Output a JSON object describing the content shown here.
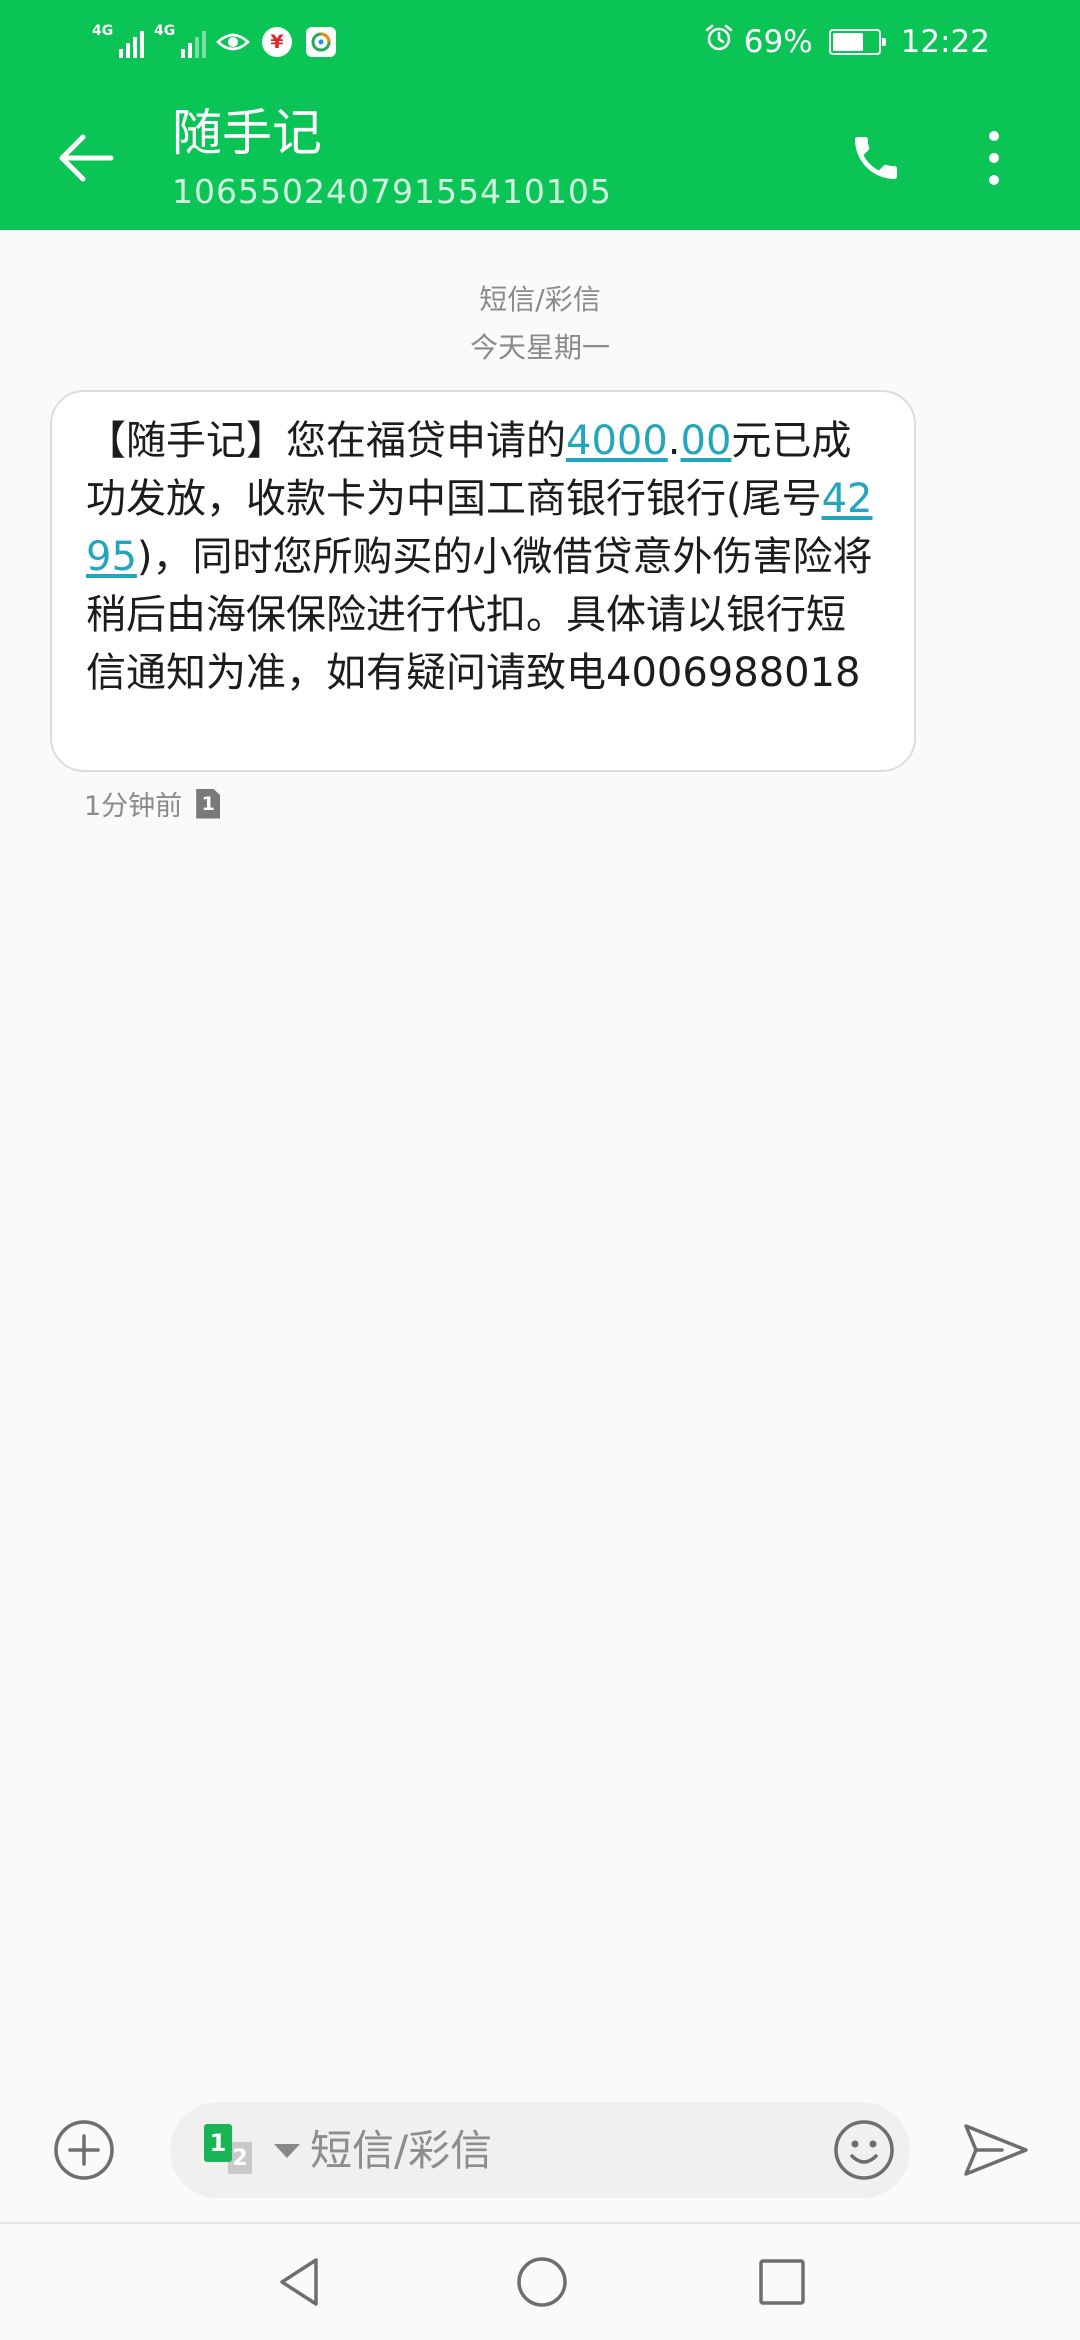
{
  "status_bar": {
    "network_1": "4G",
    "network_2": "4G",
    "battery_percent": "69%",
    "battery_level": 0.69,
    "time": "12:22",
    "icons": [
      "signal-icon",
      "signal-icon",
      "eye-icon",
      "yunshanfu-icon",
      "app-notification-icon",
      "alarm-icon",
      "battery-icon"
    ]
  },
  "header": {
    "contact_name": "随手记",
    "contact_number": "10655024079155410105",
    "background_color": "#0ac455",
    "icons": [
      "back-arrow-icon",
      "phone-icon",
      "more-vert-icon"
    ]
  },
  "conversation": {
    "sim_label": "短信/彩信",
    "date_label": "今天星期一",
    "message": {
      "parts": {
        "p1": "【随手记】您在福贷申请的",
        "amount_integer": "4000",
        "amount_dot": ".",
        "amount_decimal": "00",
        "p2": "元已成功发放，收款卡为中国工商银行银行(尾号",
        "card_tail": "4295",
        "p3": ")，同时您所购买的小微借贷意外伤害险将稍后由海保保险进行代扣。具体请以银行短信通知为准，如有疑问请致电4006988018"
      },
      "time": "1分钟前",
      "sim_slot": "1",
      "link_color": "#23a6bd"
    }
  },
  "composer": {
    "sim_primary": "1",
    "sim_secondary": "2",
    "input_placeholder": "短信/彩信",
    "input_value": "",
    "icons": [
      "add-circle-icon",
      "sim-switch-icon",
      "dropdown-caret-icon",
      "emoji-icon",
      "send-icon"
    ]
  },
  "nav_bar": {
    "icons": [
      "nav-back-icon",
      "nav-home-icon",
      "nav-recent-icon"
    ]
  }
}
